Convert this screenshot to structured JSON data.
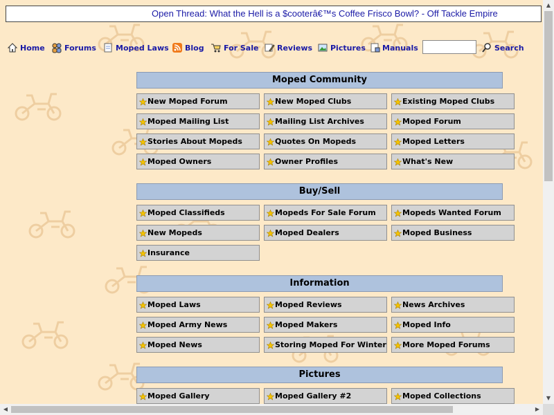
{
  "page_title": "Open Thread: What the Hell is a $cooterâ€™s Coffee Frisco Bowl? - Off Tackle Empire",
  "nav": [
    {
      "label": "Home",
      "icon": "house-icon"
    },
    {
      "label": "Forums",
      "icon": "people-icon"
    },
    {
      "label": "Moped Laws",
      "icon": "document-icon"
    },
    {
      "label": "Blog",
      "icon": "rss-icon"
    },
    {
      "label": "For Sale",
      "icon": "cart-icon"
    },
    {
      "label": "Reviews",
      "icon": "pencil-note-icon"
    },
    {
      "label": "Pictures",
      "icon": "picture-icon"
    },
    {
      "label": "Manuals",
      "icon": "manual-icon"
    },
    {
      "label": "Search",
      "icon": "magnifier-icon"
    }
  ],
  "search": {
    "value": ""
  },
  "sections": [
    {
      "title": "Moped Community",
      "links": [
        "New Moped Forum",
        "New Moped Clubs",
        "Existing Moped Clubs",
        "Moped Mailing List",
        "Mailing List Archives",
        "Moped Forum",
        "Stories About Mopeds",
        "Quotes On Mopeds",
        "Moped Letters",
        "Moped Owners",
        "Owner Profiles",
        "What's New"
      ]
    },
    {
      "title": "Buy/Sell",
      "links": [
        "Moped Classifieds",
        "Mopeds For Sale Forum",
        "Mopeds Wanted Forum",
        "New Mopeds",
        "Moped Dealers",
        "Moped Business",
        "Insurance"
      ]
    },
    {
      "title": "Information",
      "links": [
        "Moped Laws",
        "Moped Reviews",
        "News Archives",
        "Moped Army News",
        "Moped Makers",
        "Moped Info",
        "Moped News",
        "Storing Moped For Winter",
        "More Moped Forums"
      ]
    },
    {
      "title": "Pictures",
      "links": [
        "Moped Gallery",
        "Moped Gallery #2",
        "Moped Collections"
      ]
    }
  ],
  "colors": {
    "background": "#fde9c8",
    "link": "#1a1aa6",
    "section_header": "#aec2dd",
    "cell": "#d3d3d3",
    "star": "#f5c400"
  }
}
